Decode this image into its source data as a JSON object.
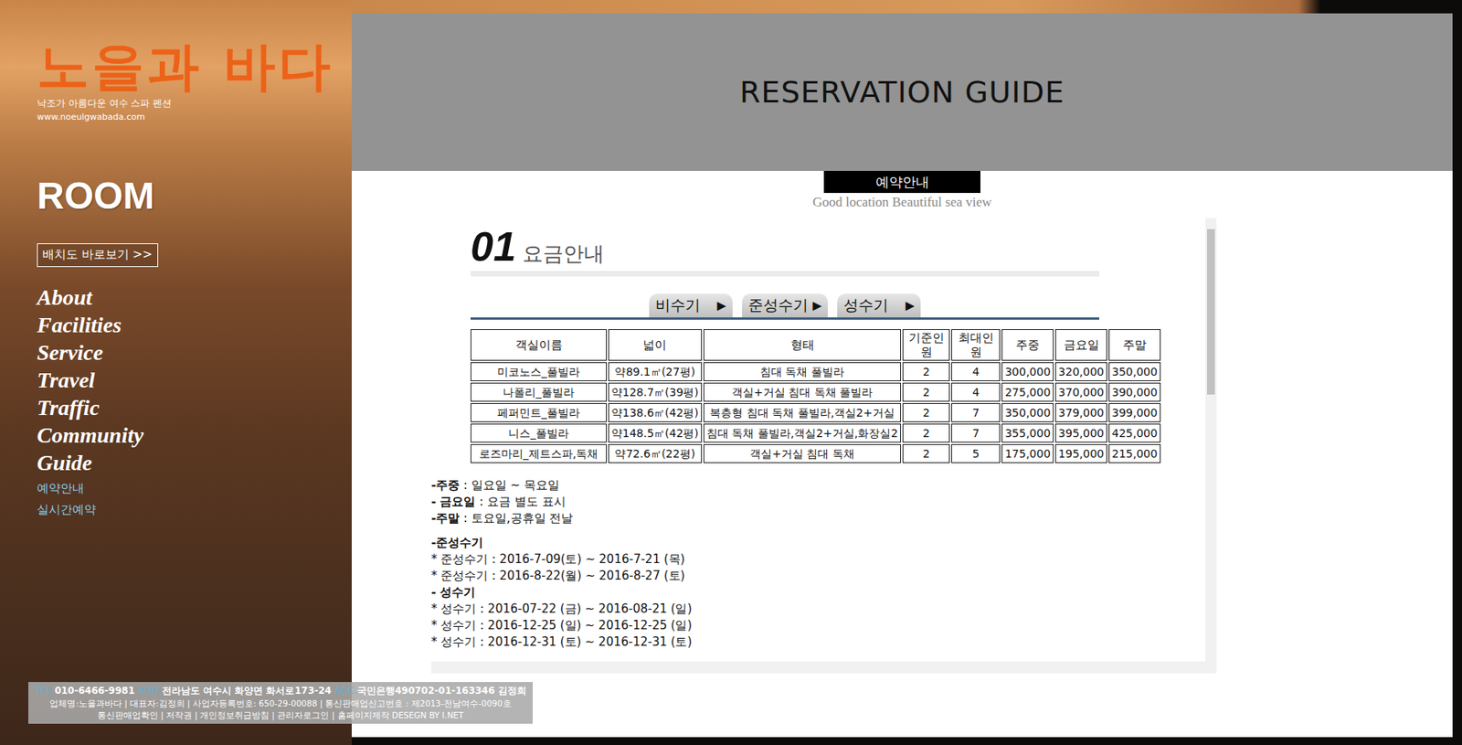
{
  "logo": {
    "title": "노을과 바다",
    "tagline": "낙조가 아름다운 여수 스파 펜션",
    "url": "www.noeulgwabada.com"
  },
  "sidebar": {
    "heading": "ROOM",
    "map_button": "배치도 바로보기 >>",
    "menu": [
      "About",
      "Facilities",
      "Service",
      "Travel",
      "Traffic",
      "Community",
      "Guide"
    ],
    "submenu": [
      "예약안내",
      "실시간예약"
    ]
  },
  "header": {
    "title": "RESERVATION GUIDE"
  },
  "badge": "예약안내",
  "subtitle": "Good location Beautiful sea view",
  "section": {
    "number": "01",
    "title": "요금안내"
  },
  "season_tabs": [
    {
      "label": "비수기",
      "arrow": "▶"
    },
    {
      "label": "준성수기",
      "arrow": "▶"
    },
    {
      "label": "성수기",
      "arrow": "▶"
    }
  ],
  "table": {
    "columns": [
      "객실이름",
      "넓이",
      "형태",
      "기준인원",
      "최대인원",
      "주중",
      "금요일",
      "주말"
    ],
    "rows": [
      [
        "미코노스_풀빌라",
        "약89.1㎡(27평)",
        "침대 독채 풀빌라",
        "2",
        "4",
        "300,000",
        "320,000",
        "350,000"
      ],
      [
        "나폴리_풀빌라",
        "약128.7㎡(39평)",
        "객실+거실 침대 독채 풀빌라",
        "2",
        "4",
        "275,000",
        "370,000",
        "390,000"
      ],
      [
        "페퍼민트_풀빌라",
        "약138.6㎡(42평)",
        "복층형 침대 독채 풀빌라,객실2+거실",
        "2",
        "7",
        "350,000",
        "379,000",
        "399,000"
      ],
      [
        "니스_풀빌라",
        "약148.5㎡(42평)",
        "침대 독채 풀빌라,객실2+거실,화장실2",
        "2",
        "7",
        "355,000",
        "395,000",
        "425,000"
      ],
      [
        "로즈마리_제트스파,독채",
        "약72.6㎡(22평)",
        "객실+거실 침대 독채",
        "2",
        "5",
        "175,000",
        "195,000",
        "215,000"
      ]
    ]
  },
  "day_notes": [
    {
      "label": "-주중",
      "text": " : 일요일 ~ 목요일"
    },
    {
      "label": "- 금요일",
      "text": " : 요금 별도 표시"
    },
    {
      "label": "-주말",
      "text": " : 토요일,공휴일 전날"
    }
  ],
  "seasons": [
    {
      "heading": "-준성수기",
      "lines": [
        "* 준성수기 : 2016-7-09(토) ~ 2016-7-21 (목)",
        "* 준성수기 : 2016-8-22(월) ~ 2016-8-27 (토)"
      ]
    },
    {
      "heading": "- 성수기",
      "lines": [
        "* 성수기 : 2016-07-22 (금) ~ 2016-08-21 (일)",
        "* 성수기 : 2016-12-25 (일) ~ 2016-12-25 (일)",
        "* 성수기 : 2016-12-31 (토) ~ 2016-12-31 (토)"
      ]
    }
  ],
  "footer": {
    "contact": [
      {
        "label": "TEL.",
        "value": "010-6466-9981 "
      },
      {
        "label": "ADD.",
        "value": "전라남도 여수시 화양면 화서로173-24 "
      },
      {
        "label": "ACC.",
        "value": "국민은행490702-01-163346 김정희"
      }
    ],
    "info": "업체명:노을과바다 | 대표자:김정희 | 사업자등록번호: 650-29-00088 | 통신판매업신고번호 : 제2013-전남여수-0090호",
    "links": "통신판매업확인 | 저작권 | 개인정보취급방침 | 관리자로그인 | 홈페이지제작 DESEGN BY I.NET"
  }
}
